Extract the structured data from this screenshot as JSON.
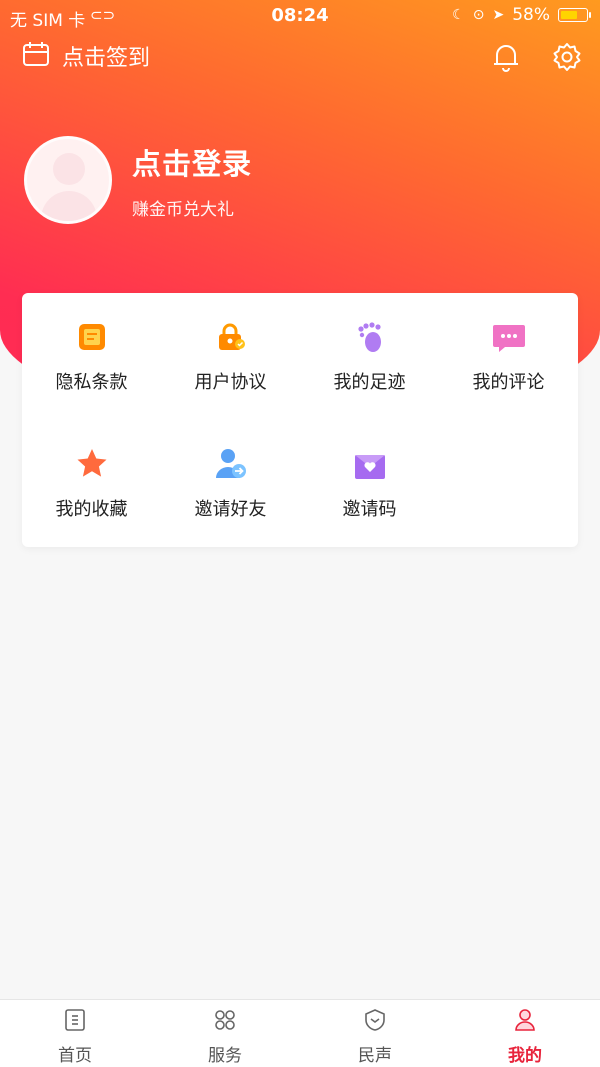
{
  "status_bar": {
    "carrier": "无 SIM 卡",
    "time": "08:24",
    "battery": "58%",
    "battery_level": 0.58
  },
  "header": {
    "checkin_label": "点击签到",
    "login_title": "点击登录",
    "login_subtitle": "赚金币兑大礼"
  },
  "menu": {
    "items": [
      {
        "label": "隐私条款",
        "icon": "privacy-icon"
      },
      {
        "label": "用户协议",
        "icon": "agreement-lock-icon"
      },
      {
        "label": "我的足迹",
        "icon": "footprint-icon"
      },
      {
        "label": "我的评论",
        "icon": "comment-icon"
      },
      {
        "label": "我的收藏",
        "icon": "star-icon"
      },
      {
        "label": "邀请好友",
        "icon": "invite-user-icon"
      },
      {
        "label": "邀请码",
        "icon": "invite-code-icon"
      }
    ]
  },
  "tabbar": {
    "tabs": [
      {
        "label": "首页",
        "icon": "home-icon"
      },
      {
        "label": "服务",
        "icon": "services-icon"
      },
      {
        "label": "民声",
        "icon": "voice-icon"
      },
      {
        "label": "我的",
        "icon": "profile-icon"
      }
    ],
    "active": "我的"
  },
  "colors": {
    "header_gradient_start": "#ff2a55",
    "header_gradient_end": "#ff9a1f",
    "active_tab": "#e8243c"
  }
}
